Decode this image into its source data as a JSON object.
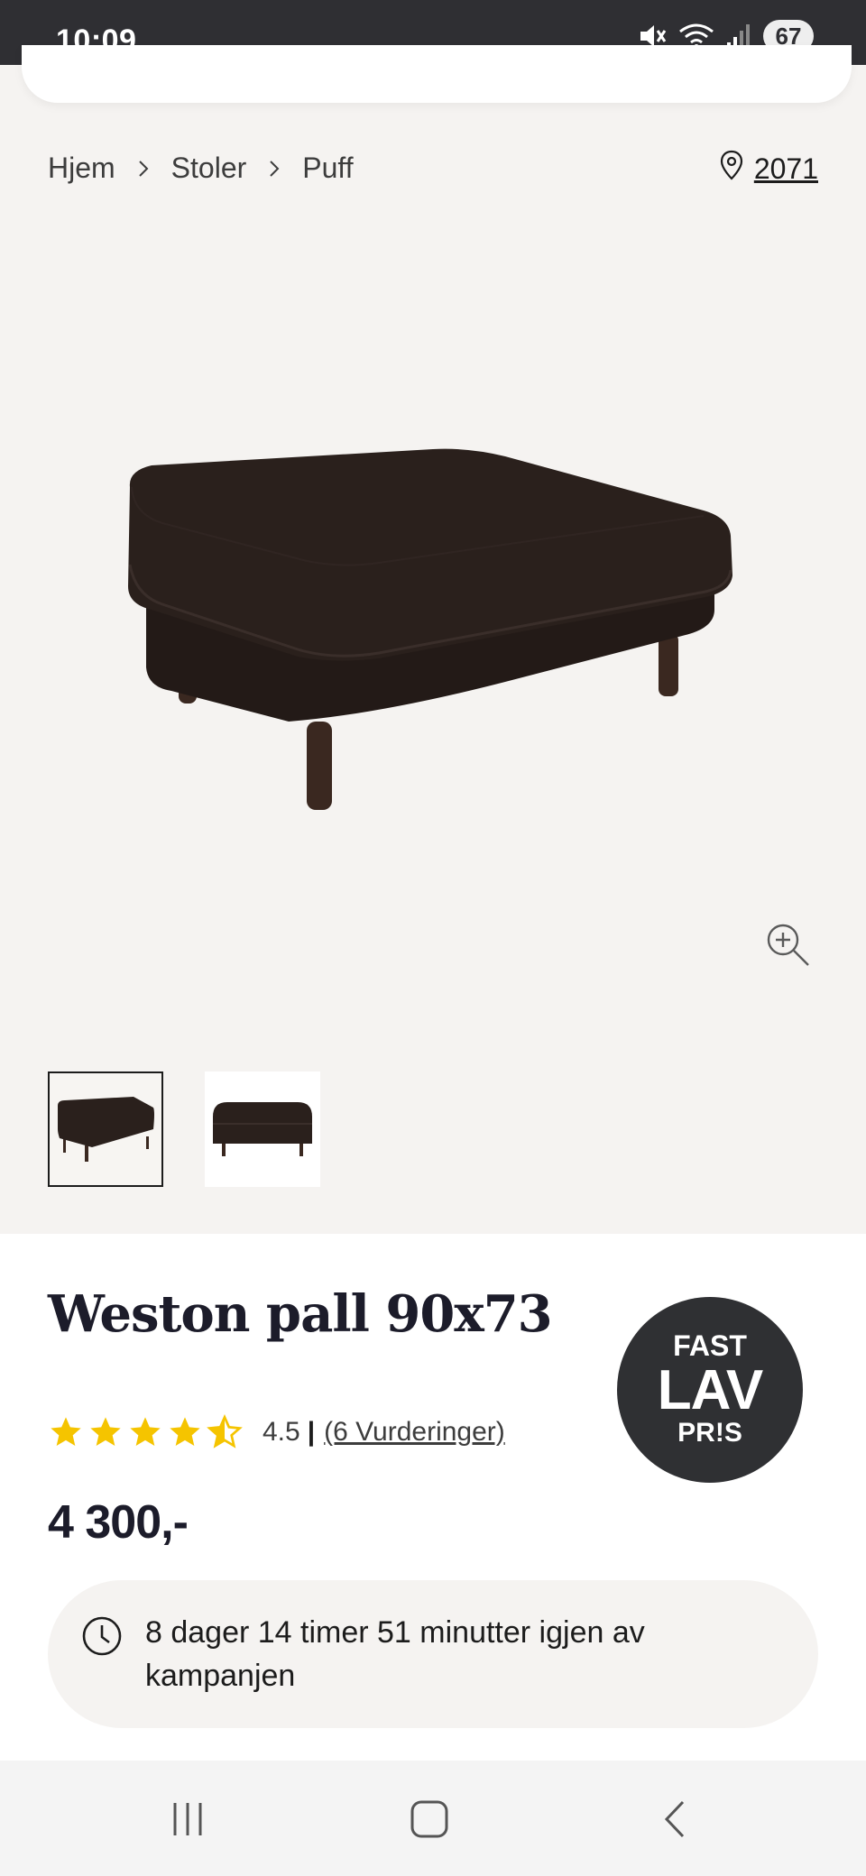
{
  "status_bar": {
    "time": "10:09",
    "battery": "67",
    "icons": [
      "mute-icon",
      "wifi-icon",
      "signal-icon",
      "battery-icon"
    ]
  },
  "breadcrumb": {
    "items": [
      "Hjem",
      "Stoler",
      "Puff"
    ]
  },
  "store": {
    "code": "2071"
  },
  "product": {
    "title": "Weston pall 90x73",
    "rating_value": "4.5",
    "rating_separator": "|",
    "rating_count": "(6 Vurderinger)",
    "stars": 4.5,
    "price": "4 300,-",
    "image_count": 2
  },
  "badge": {
    "line1": "FAST",
    "line2": "LAV",
    "line3": "PR!S"
  },
  "campaign": {
    "text": "8 dager 14 timer 51 minutter igjen av kampanjen"
  },
  "colors": {
    "star": "#f5c400",
    "badge_bg": "#2f3033",
    "page_bg": "#f5f3f1"
  }
}
